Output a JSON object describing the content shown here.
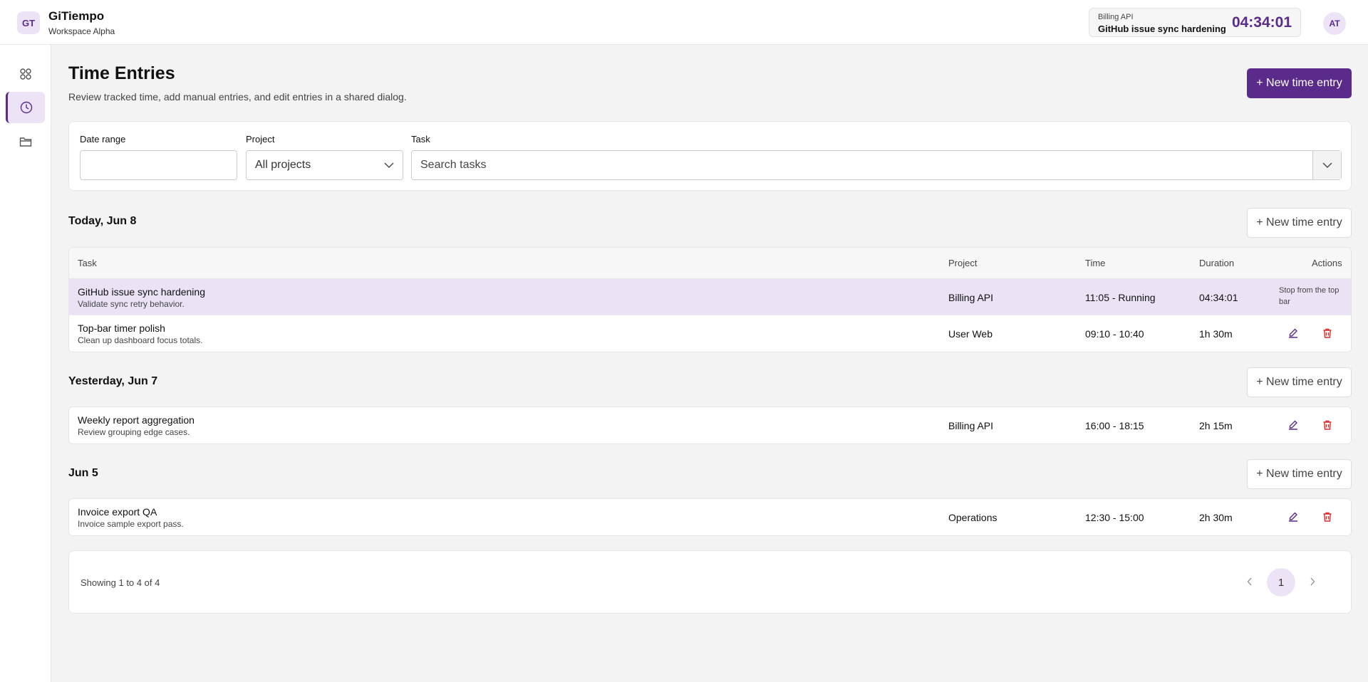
{
  "app": {
    "logo": "GT",
    "name": "GiTiempo",
    "workspace": "Workspace Alpha",
    "avatar": "AT"
  },
  "timer": {
    "project": "Billing API",
    "task": "GitHub issue sync hardening",
    "elapsed": "04:34:01"
  },
  "sidebar": {
    "items": [
      {
        "icon": "dashboard-icon",
        "active": false
      },
      {
        "icon": "clock-icon",
        "active": true
      },
      {
        "icon": "folder-icon",
        "active": false
      }
    ]
  },
  "header": {
    "title": "Time Entries",
    "description": "Review tracked time, add manual entries, and edit entries in a shared dialog.",
    "new_entry_label": "+ New time entry"
  },
  "filters": {
    "date_label": "Date range",
    "date_value": "",
    "project_label": "Project",
    "project_value": "All projects",
    "task_label": "Task",
    "task_placeholder": "Search tasks"
  },
  "table_headers": {
    "task": "Task",
    "project": "Project",
    "time": "Time",
    "duration": "Duration",
    "actions": "Actions"
  },
  "groups": [
    {
      "title": "Today, Jun 8",
      "new_entry_label": "+ New time entry",
      "entries": [
        {
          "task": "GitHub issue sync hardening",
          "desc": "Validate sync retry behavior.",
          "project": "Billing API",
          "time": "11:05 - Running",
          "duration": "04:34:01",
          "note": "Stop from the top bar"
        },
        {
          "task": "Top-bar timer polish",
          "desc": "Clean up dashboard focus totals.",
          "project": "User Web",
          "time": "09:10 - 10:40",
          "duration": "1h 30m"
        }
      ]
    },
    {
      "title": "Yesterday, Jun 7",
      "new_entry_label": "+ New time entry",
      "entries": [
        {
          "task": "Weekly report aggregation",
          "desc": "Review grouping edge cases.",
          "project": "Billing API",
          "time": "16:00 - 18:15",
          "duration": "2h 15m"
        }
      ]
    },
    {
      "title": "Jun 5",
      "new_entry_label": "+ New time entry",
      "entries": [
        {
          "task": "Invoice export QA",
          "desc": "Invoice sample export pass.",
          "project": "Operations",
          "time": "12:30 - 15:00",
          "duration": "2h 30m"
        }
      ]
    }
  ],
  "pagination": {
    "summary": "Showing 1 to 4 of 4",
    "current_page": "1"
  },
  "colors": {
    "accent": "#5b2b8c",
    "accent_light": "#ece4f6",
    "running_row": "#ebe3f5",
    "delete": "#d92b2b"
  }
}
